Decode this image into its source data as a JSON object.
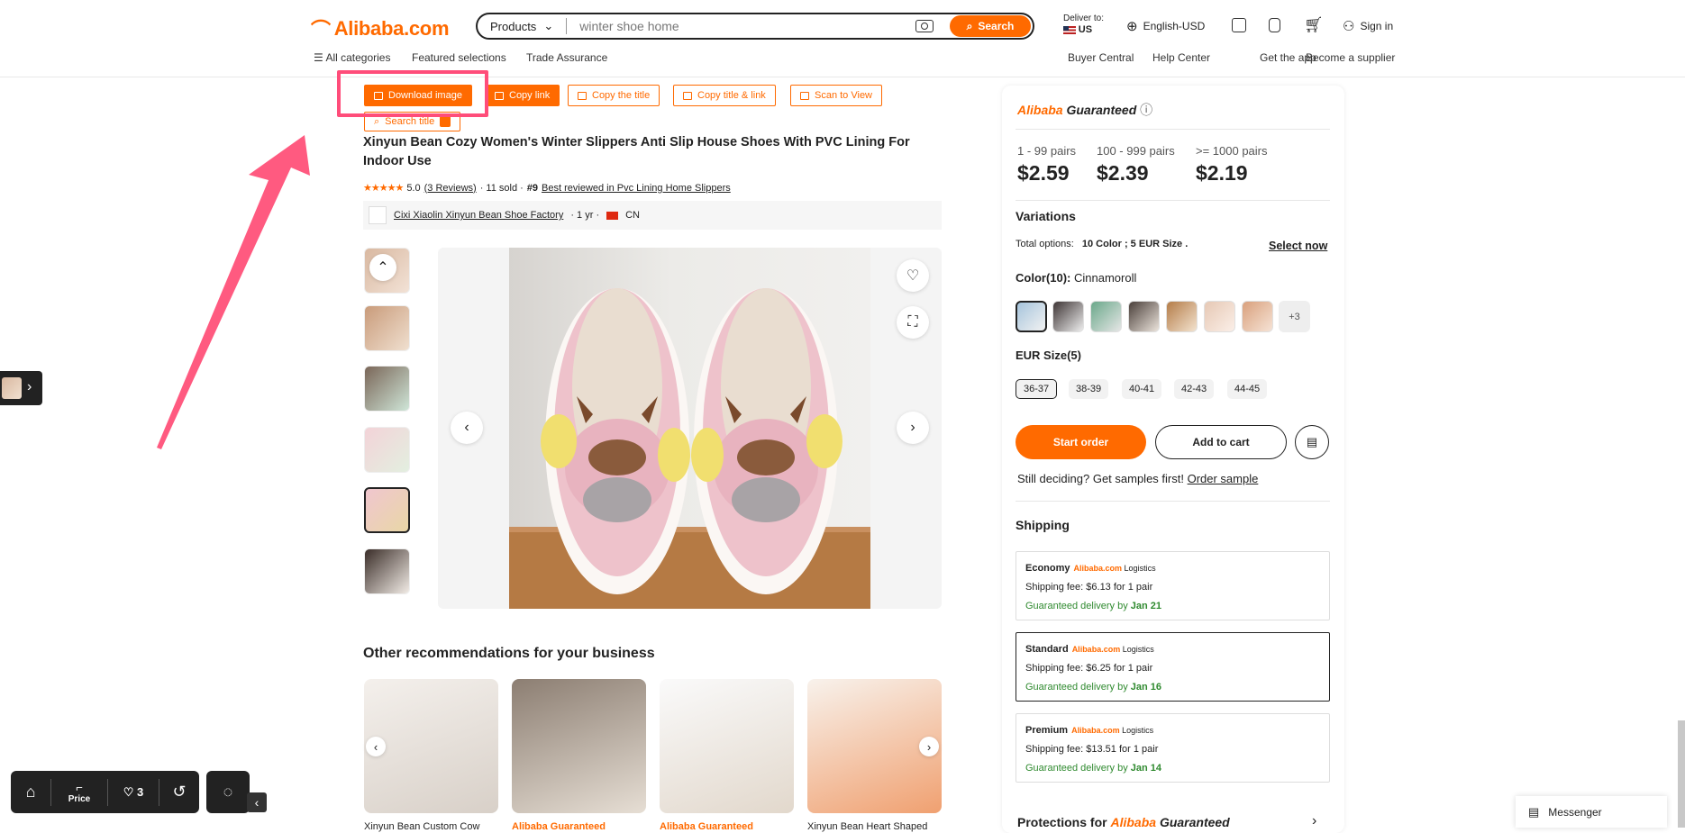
{
  "header": {
    "logo_text": "Alibaba.com",
    "search_category": "Products",
    "search_query": "winter shoe home",
    "search_button": "Search",
    "deliver_to_label": "Deliver to:",
    "deliver_to_country": "US",
    "language": "English-USD",
    "sign_in": "Sign in",
    "nav_left": [
      "All categories",
      "Featured selections",
      "Trade Assurance"
    ],
    "nav_right": [
      "Buyer Central",
      "Help Center",
      "Get the app",
      "Become a supplier"
    ]
  },
  "actions": {
    "download_image": "Download image",
    "copy_link": "Copy link",
    "copy_title": "Copy the title",
    "copy_title_link": "Copy title & link",
    "scan_to_view": "Scan to View",
    "search_title": "Search title"
  },
  "product": {
    "title": "Xinyun Bean Cozy Women's Winter Slippers Anti Slip House Shoes With PVC Lining For Indoor Use",
    "rating": "5.0",
    "reviews": "(3 Reviews)",
    "sold": "· 11 sold ·",
    "rank": "#9",
    "rank_text": "Best reviewed in Pvc Lining Home Slippers",
    "supplier": "Cixi Xiaolin Xinyun Bean Shoe Factory",
    "supplier_years": "· 1 yr ·",
    "supplier_country": "CN"
  },
  "recommend": {
    "title": "Other recommendations for your business",
    "labels": [
      "Xinyun Bean Custom Cow",
      "Alibaba Guaranteed",
      "Alibaba Guaranteed",
      "Xinyun Bean Heart Shaped"
    ]
  },
  "panel": {
    "guaranteed_brand": "Alibaba",
    "guaranteed_word": "Guaranteed",
    "tiers": [
      {
        "qty": "1 - 99 pairs",
        "price": "$2.59"
      },
      {
        "qty": "100 - 999 pairs",
        "price": "$2.39"
      },
      {
        "qty": ">= 1000 pairs",
        "price": "$2.19"
      }
    ],
    "variations_title": "Variations",
    "total_options_label": "Total options:",
    "total_options_value": "10 Color ; 5 EUR Size .",
    "select_now": "Select now",
    "color_label": "Color(10):",
    "color_value": "Cinnamoroll",
    "more_colors": "+3",
    "size_label": "EUR Size(5)",
    "sizes": [
      "36-37",
      "38-39",
      "40-41",
      "42-43",
      "44-45"
    ],
    "start_order": "Start order",
    "add_to_cart": "Add to cart",
    "samples_text": "Still deciding? Get samples first!",
    "order_sample": "Order sample",
    "shipping_title": "Shipping",
    "shipping": [
      {
        "name": "Economy",
        "fee": "Shipping fee: $6.13 for 1 pair",
        "guarantee": "Guaranteed delivery by",
        "date": "Jan 21"
      },
      {
        "name": "Standard",
        "fee": "Shipping fee: $6.25 for 1 pair",
        "guarantee": "Guaranteed delivery by",
        "date": "Jan 16"
      },
      {
        "name": "Premium",
        "fee": "Shipping fee: $13.51 for 1 pair",
        "guarantee": "Guaranteed delivery by",
        "date": "Jan 14"
      }
    ],
    "logistics_brand": "Alibaba.com",
    "logistics_word": "Logistics",
    "protections_label": "Protections for"
  },
  "bottom": {
    "price_label": "Price",
    "favorites_count": "3",
    "messenger": "Messenger"
  },
  "colors": {
    "accent": "#ff6a00",
    "annotation": "#ff4d7a",
    "guarantee_green": "#2f8a2f"
  }
}
